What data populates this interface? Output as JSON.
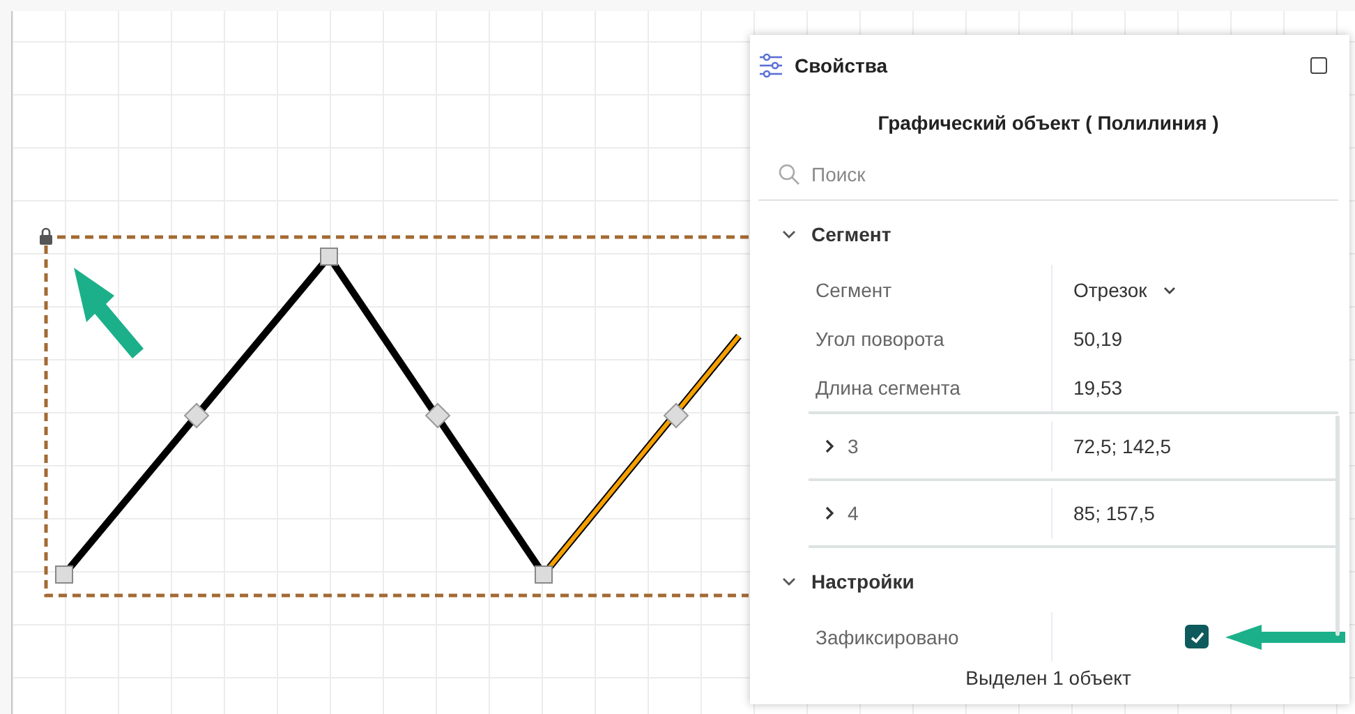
{
  "panel": {
    "title": "Свойства",
    "object_title": "Графический объект ( Полилиния )",
    "search": {
      "placeholder": "Поиск"
    },
    "sections": [
      {
        "title": "Сегмент",
        "expanded": true,
        "rows": [
          {
            "kind": "dropdown",
            "label": "Сегмент",
            "value": "Отрезок"
          },
          {
            "kind": "text",
            "label": "Угол поворота",
            "value": "50,19"
          },
          {
            "kind": "text",
            "label": "Длина сегмента",
            "value": "19,53"
          },
          {
            "kind": "point",
            "label": "3",
            "value": "72,5; 142,5",
            "expanded": false
          },
          {
            "kind": "point",
            "label": "4",
            "value": "85; 157,5",
            "expanded": false
          }
        ]
      },
      {
        "title": "Настройки",
        "expanded": true,
        "rows": [
          {
            "kind": "checkbox",
            "label": "Зафиксировано",
            "checked": true
          }
        ]
      }
    ],
    "status": "Выделен 1 объект"
  },
  "canvas": {
    "locked": true
  }
}
